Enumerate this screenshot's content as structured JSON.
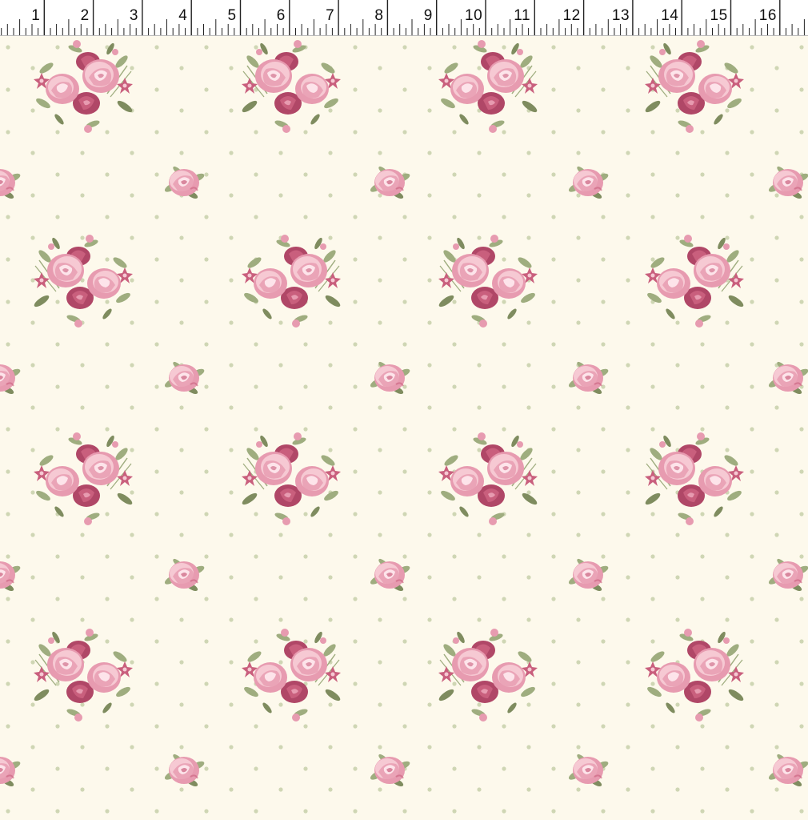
{
  "ruler": {
    "unit_label_values": [
      "1",
      "2",
      "3",
      "4",
      "5",
      "6",
      "7",
      "8",
      "9",
      "10",
      "11",
      "12",
      "13",
      "14",
      "15",
      "16"
    ],
    "tick_icon": "ruler-tick-icon"
  },
  "fabric": {
    "description_icon": "rose-bouquet-icon",
    "single_rose_icon": "single-rose-icon",
    "dot_icon": "polka-dot-icon",
    "colors": {
      "background": "#fdf9ec",
      "rose_light": "#f6c9d3",
      "rose_mid": "#e79bb0",
      "rose_dark": "#c95f7d",
      "rose_deep": "#b04767",
      "leaf": "#9fad7f",
      "leaf_dark": "#7f8c5f",
      "dot": "#cfd6b4"
    }
  }
}
